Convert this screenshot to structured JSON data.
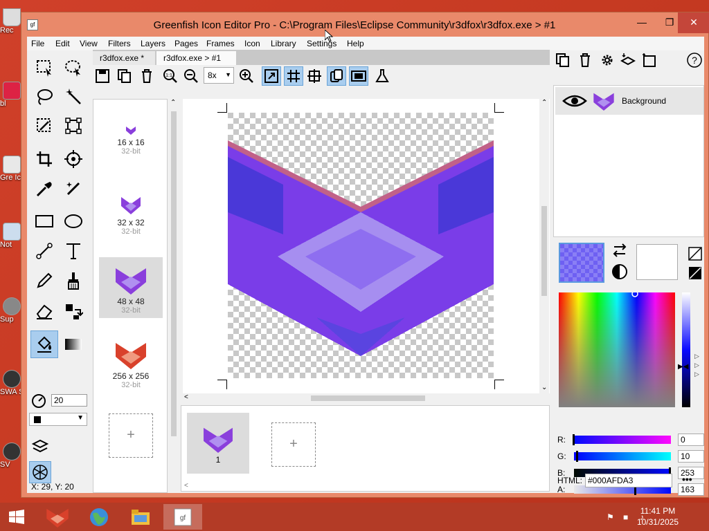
{
  "window": {
    "title": "Greenfish Icon Editor Pro - C:\\Program Files\\Eclipse Community\\r3dfox\\r3dfox.exe > #1",
    "app_icon_text": "gf"
  },
  "desktop_icons": [
    "Rec",
    "bl",
    "Gre Ico",
    "Not",
    "Sup",
    "SWA Steo",
    "SV"
  ],
  "menu": [
    "File",
    "Edit",
    "View",
    "Filters",
    "Layers",
    "Pages",
    "Frames",
    "Icon",
    "Library",
    "Settings",
    "Help"
  ],
  "tabs": [
    "r3dfox.exe *",
    "r3dfox.exe > #1"
  ],
  "toolbar": {
    "zoom": "8x"
  },
  "tool_options": {
    "opacity": "20"
  },
  "formats": [
    {
      "size": "16 x 16",
      "depth": "32-bit"
    },
    {
      "size": "32 x 32",
      "depth": "32-bit"
    },
    {
      "size": "48 x 48",
      "depth": "32-bit"
    },
    {
      "size": "256 x 256",
      "depth": "32-bit"
    }
  ],
  "add_label": "+",
  "frames": [
    {
      "label": "1"
    }
  ],
  "layers": [
    {
      "name": "Background"
    }
  ],
  "color": {
    "r": "0",
    "g": "10",
    "b": "253",
    "a": "163",
    "html": "#000AFDA3",
    "labels": {
      "r": "R:",
      "g": "G:",
      "b": "B:",
      "a": "A:",
      "html": "HTML:"
    },
    "more": "•••",
    "primary_hex": "#6e55f0"
  },
  "status": "X: 29, Y: 20",
  "taskbar": {
    "time": "11:41 PM",
    "date": "10/31/2025"
  }
}
